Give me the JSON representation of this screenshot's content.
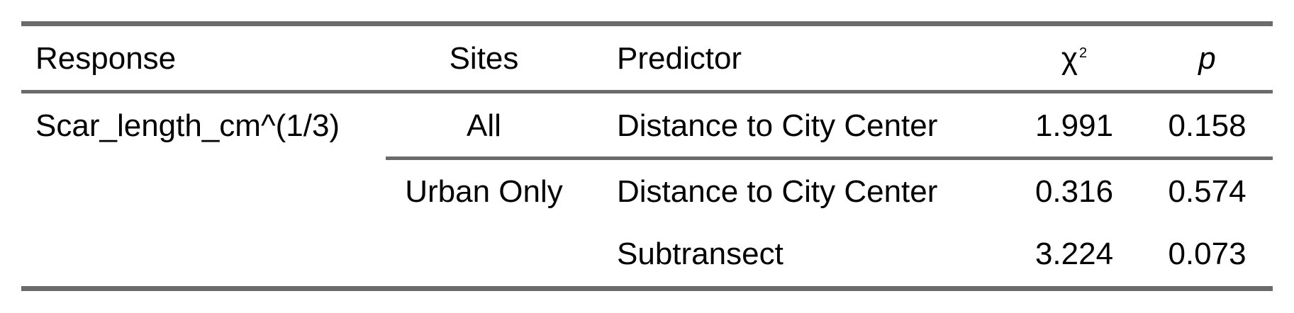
{
  "chart_data": {
    "type": "table",
    "columns": [
      {
        "key": "response",
        "label": "Response"
      },
      {
        "key": "sites",
        "label": "Sites"
      },
      {
        "key": "predictor",
        "label": "Predictor"
      },
      {
        "key": "chi2",
        "label": "χ",
        "sup": "2"
      },
      {
        "key": "p",
        "label": "p"
      }
    ],
    "rows": [
      {
        "response": "Scar_length_cm^(1/3)",
        "sites": "All",
        "predictor": "Distance to City Center",
        "chi2": "1.991",
        "p": "0.158"
      },
      {
        "response": "",
        "sites": "Urban Only",
        "predictor": "Distance to City Center",
        "chi2": "0.316",
        "p": "0.574"
      },
      {
        "response": "",
        "sites": "",
        "predictor": "Subtransect",
        "chi2": "3.224",
        "p": "0.073"
      }
    ]
  }
}
